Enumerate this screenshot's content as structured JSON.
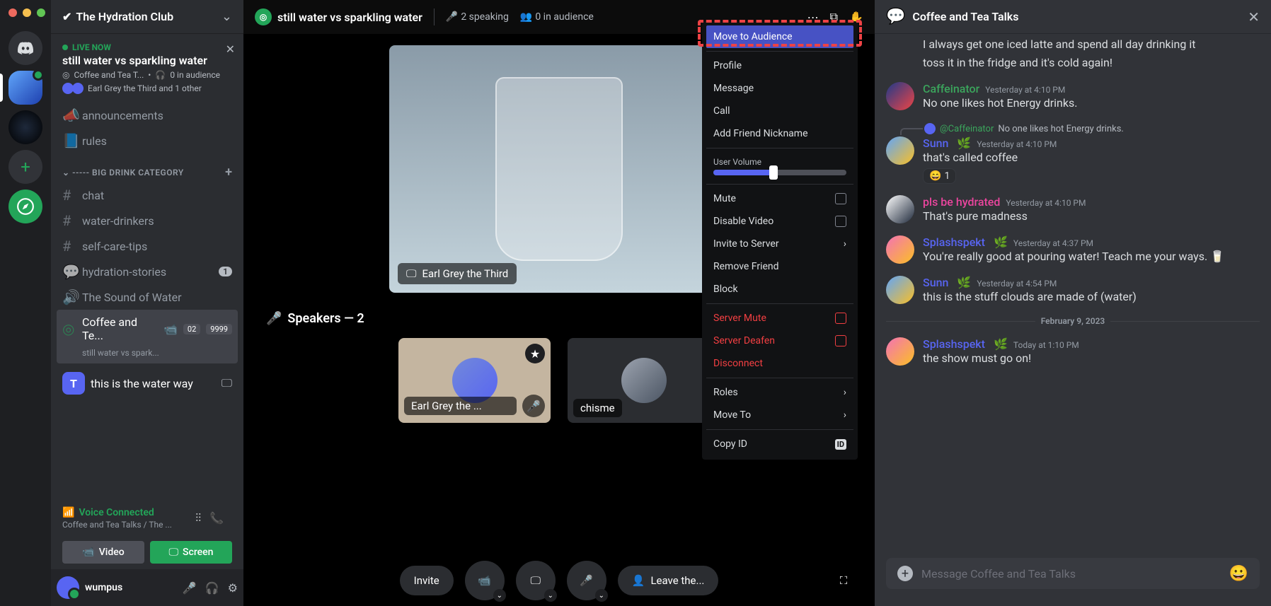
{
  "traffic_lights": [
    "red",
    "yellow",
    "green"
  ],
  "server": {
    "name": "The Hydration Club"
  },
  "live": {
    "tag": "LIVE NOW",
    "title": "still water vs sparkling water",
    "channel": "Coffee and Tea T...",
    "audience": "0 in audience",
    "people": "Earl Grey the Third and 1 other"
  },
  "channels": {
    "top": [
      {
        "icon": "megaphone",
        "label": "announcements"
      },
      {
        "icon": "rules",
        "label": "rules"
      }
    ],
    "category": "----- BIG DRINK CATEGORY",
    "list": [
      {
        "icon": "#",
        "label": "chat"
      },
      {
        "icon": "#",
        "label": "water-drinkers"
      },
      {
        "icon": "#",
        "label": "self-care-tips"
      },
      {
        "icon": "thread",
        "label": "hydration-stories",
        "badge": "1"
      },
      {
        "icon": "speaker",
        "label": "The Sound of Water"
      }
    ],
    "stage": {
      "label": "Coffee and Te...",
      "sub": "still water vs spark...",
      "count1": "02",
      "count2": "9999"
    },
    "water_way": "this is the water way"
  },
  "voice": {
    "status": "Voice Connected",
    "path": "Coffee and Tea Talks / The ...",
    "video_btn": "Video",
    "screen_btn": "Screen"
  },
  "user": {
    "name": "wumpus"
  },
  "stage": {
    "title": "still water vs sparkling water",
    "speaking": "2 speaking",
    "audience": "0 in audience",
    "video_label": "Earl Grey the Third",
    "speakers_label": "Speakers — 2",
    "speakers": [
      {
        "name": "Earl Grey the ..."
      },
      {
        "name": "chisme"
      }
    ],
    "footer": {
      "invite": "Invite",
      "leave": "Leave the..."
    }
  },
  "context_menu": {
    "move_audience": "Move to Audience",
    "profile": "Profile",
    "message": "Message",
    "call": "Call",
    "add_friend_nickname": "Add Friend Nickname",
    "user_volume": "User Volume",
    "mute": "Mute",
    "disable_video": "Disable Video",
    "invite_server": "Invite to Server",
    "remove_friend": "Remove Friend",
    "block": "Block",
    "server_mute": "Server Mute",
    "server_deafen": "Server Deafen",
    "disconnect": "Disconnect",
    "roles": "Roles",
    "move_to": "Move To",
    "copy_id": "Copy ID"
  },
  "chat": {
    "title": "Coffee and Tea Talks",
    "input_placeholder": "Message Coffee and Tea Talks",
    "date_divider": "February 9, 2023",
    "messages": [
      {
        "type": "continue",
        "text": "I always get one iced latte and spend all day drinking it"
      },
      {
        "type": "continue",
        "text": "toss it in the fridge and it's cold again!"
      },
      {
        "type": "msg",
        "author": "Caffeinator",
        "author_class": "c-caffe",
        "av": "av1",
        "time": "Yesterday at 4:10 PM",
        "text": "No one likes hot Energy drinks."
      },
      {
        "type": "reply",
        "reply_user": "@Caffeinator",
        "reply_text": "No one likes hot Energy drinks.",
        "author": "Sunn",
        "author_class": "c-sunn",
        "av": "av2",
        "leaf": true,
        "time": "Yesterday at 4:10 PM",
        "text": "that's called coffee",
        "reaction": {
          "emoji": "😄",
          "count": "1"
        }
      },
      {
        "type": "msg",
        "author": "pls be hydrated",
        "author_class": "c-hydrated",
        "av": "av3",
        "time": "Yesterday at 4:10 PM",
        "text": "That's pure madness"
      },
      {
        "type": "msg",
        "author": "Splashspekt",
        "author_class": "c-splash",
        "av": "av4",
        "leaf": true,
        "time": "Yesterday at 4:37 PM",
        "text": "You're really good at pouring water! Teach me your ways. 🥛"
      },
      {
        "type": "msg",
        "author": "Sunn",
        "author_class": "c-sunn",
        "av": "av2",
        "leaf": true,
        "time": "Yesterday at 4:54 PM",
        "text": "this is the stuff clouds are made of (water)"
      },
      {
        "type": "divider"
      },
      {
        "type": "msg",
        "author": "Splashspekt",
        "author_class": "c-splash",
        "av": "av4",
        "leaf": true,
        "time": "Today at 1:10 PM",
        "text": "the show must go on!"
      }
    ]
  }
}
